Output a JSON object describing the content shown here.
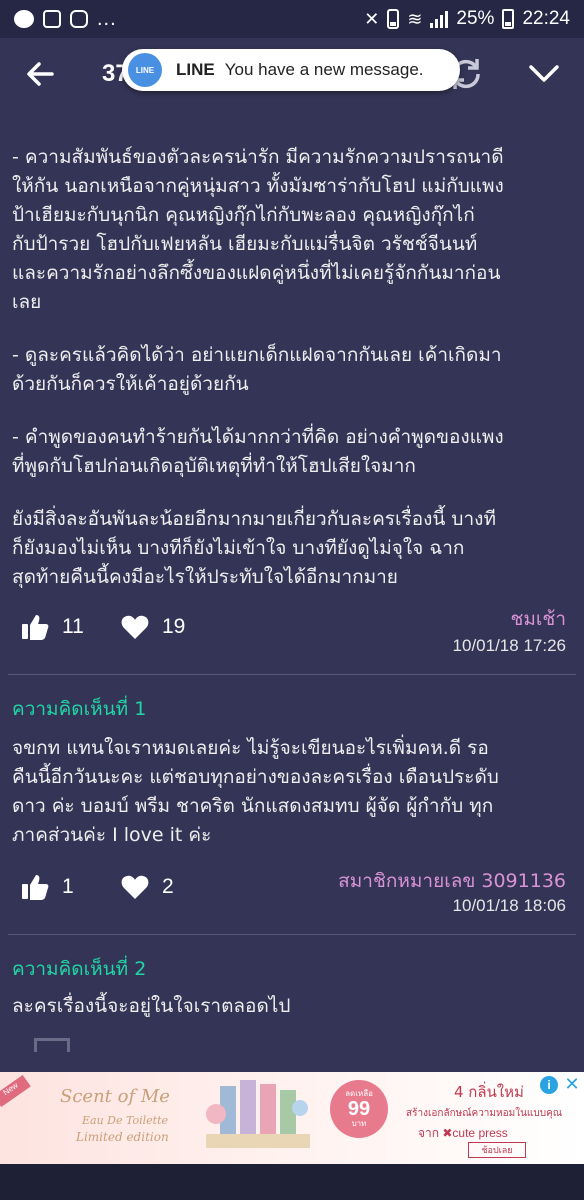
{
  "status_bar": {
    "dots": "...",
    "battery": "25%",
    "time": "22:24"
  },
  "header": {
    "title_partial": "37",
    "back_icon": "arrow-left-icon",
    "refresh_icon": "refresh-icon",
    "collapse_icon": "chevron-down-icon"
  },
  "notification": {
    "logo_text": "LINE",
    "app": "LINE",
    "message": "You have a new message."
  },
  "post": {
    "lines": [
      "- ความสัมพันธ์ของตัวละครน่ารัก มีความรักความปรารถนาดี",
      "ให้กัน นอกเหนือจากคู่หนุ่มสาว ทั้งมัมซาร่ากับโฮป แม่กับแพง",
      "ป้าเฮียมะกับนุกนิก  คุณหญิงกุ๊กไก่กับพะลอง คุณหญิงกุ๊กไก่",
      "กับป้ารวย โฮปกับเฟยหลัน เฮียมะกับแม่รื่นจิต วรัชช์จีนนท์",
      "และความรักอย่างลึกซึ้งของแฝดคู่หนึ่งที่ไม่เคยรู้จักกันมาก่อน",
      "เลย",
      "",
      "- ดูละครแล้วคิดได้ว่า อย่าแยกเด็กแฝดจากกันเลย เค้าเกิดมา",
      "ด้วยกันก็ควรให้เค้าอยู่ด้วยกัน",
      "",
      "- คำพูดของคนทำร้ายกันได้มากกว่าที่คิด อย่างคำพูดของแพง",
      "ที่พูดกับโฮปก่อนเกิดอุบัติเหตุที่ทำให้โฮปเสียใจมาก",
      "",
      "ยังมีสิ่งละอันพันละน้อยอีกมากมายเกี่ยวกับละครเรื่องนี้ บางที",
      "ก็ยังมองไม่เห็น บางทีก็ยังไม่เข้าใจ บางทียังดูไม่จุใจ ฉาก",
      "สุดท้ายคืนนี้คงมีอะไรให้ประทับใจได้อีกมากมาย"
    ],
    "likes": "11",
    "hearts": "19",
    "author": "ชมเช้า",
    "date": "10/01/18 17:26"
  },
  "comments": [
    {
      "heading": "ความคิดเห็นที่ 1",
      "lines": [
        "จขกท แทนใจเราหมดเลยค่ะ ไม่รู้จะเขียนอะไรเพิ่มคห.ดี รอ",
        "คืนนี้อีกวันนะคะ แต่ชอบทุกอย่างของละครเรื่อง เดือนประดับ",
        "ดาว ค่ะ บอมบ์ พรีม ชาคริต นักแสดงสมทบ ผู้จัด ผู้กำกับ ทุก",
        "ภาคส่วนค่ะ I love it ค่ะ"
      ],
      "likes": "1",
      "hearts": "2",
      "author": "สมาชิกหมายเลข 3091136",
      "date": "10/01/18 18:06"
    },
    {
      "heading": "ความคิดเห็นที่ 2",
      "lines": [
        "ละครเรื่องนี้จะอยู่ในใจเราตลอดไป"
      ]
    }
  ],
  "ad": {
    "new_tag": "New",
    "script": "Scent of Me",
    "sub1": "Eau De Toilette",
    "sub2": "Limited edition",
    "badge_line1": "ลดเหลือ",
    "price": "99",
    "badge_line2": "บาท",
    "headline": "4 กลิ่นใหม่",
    "line": "สร้างเอกลักษณ์ความหอมในแบบคุณ",
    "brand": "จาก ✖cute press",
    "button": "ช้อปเลย",
    "choices_icon": "ad-choices-icon",
    "close_icon": "close-icon"
  },
  "colors": {
    "background": "#343457",
    "status_bar": "#262744",
    "accent_green": "#1fd6a4",
    "author_pink": "#d993d6"
  }
}
